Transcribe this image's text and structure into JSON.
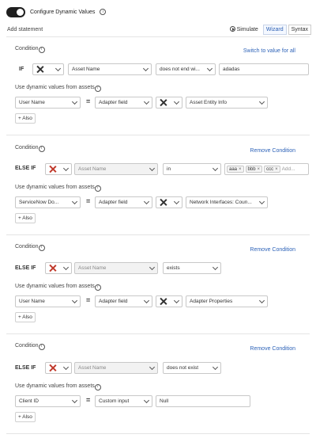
{
  "header": {
    "title": "Configure Dynamic Values",
    "enabled": true
  },
  "toolbar": {
    "add_statement": "Add statement",
    "simulate": "Simulate",
    "wizard": "Wizard",
    "syntax": "Syntax"
  },
  "blocks": [
    {
      "condition_label": "Condition",
      "right_link": "Switch to value for all",
      "keyword": "IF",
      "field": "Asset Name",
      "operator": "does not end wi...",
      "value": "adadas",
      "dyn_label": "Use dynamic values from assets",
      "target": "User Name",
      "source": "Adapter field",
      "source_field": "Asset Entity Info",
      "also": "+ Also"
    },
    {
      "condition_label": "Condition",
      "right_link": "Remove Condition",
      "keyword": "ELSE IF",
      "field": "Asset Name",
      "operator": "in",
      "tags": [
        "aaa",
        "bbb",
        "ccc"
      ],
      "add_placeholder": "Add...",
      "dyn_label": "Use dynamic values from assets",
      "target": "ServiceNow Do...",
      "source": "Adapter field",
      "source_field": "Network Interfaces: Coun...",
      "also": "+ Also"
    },
    {
      "condition_label": "Condition",
      "right_link": "Remove Condition",
      "keyword": "ELSE IF",
      "field": "Asset Name",
      "operator": "exists",
      "dyn_label": "Use dynamic values from assets",
      "target": "User Name",
      "source": "Adapter field",
      "source_field": "Adapter Properties",
      "also": "+ Also"
    },
    {
      "condition_label": "Condition",
      "right_link": "Remove Condition",
      "keyword": "ELSE IF",
      "field": "Asset Name",
      "operator": "does not exist",
      "dyn_label": "Use dynamic values from assets",
      "target": "Client ID",
      "source": "Custom input",
      "custom_value": "Null",
      "also": "+ Also"
    }
  ],
  "equals": "="
}
